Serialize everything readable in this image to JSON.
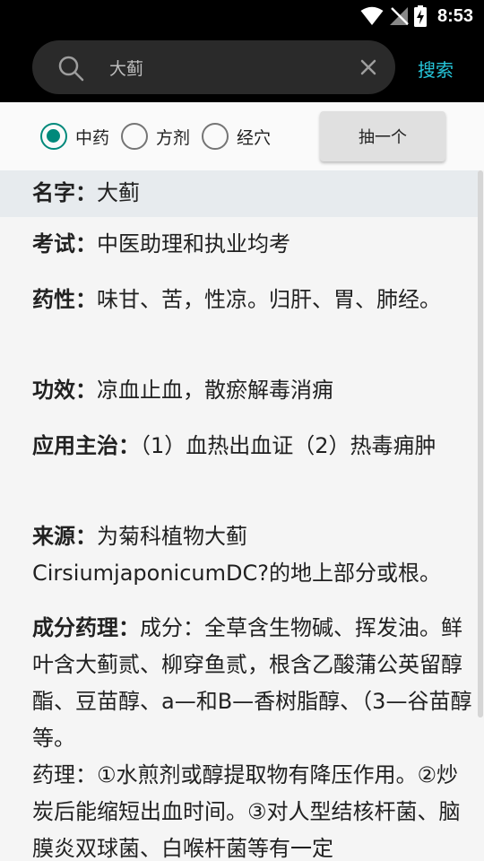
{
  "status_bar": {
    "time": "8:53"
  },
  "search": {
    "value": "大蓟",
    "button_label": "搜索"
  },
  "filters": {
    "options": [
      {
        "label": "中药",
        "checked": true
      },
      {
        "label": "方剂",
        "checked": false
      },
      {
        "label": "经穴",
        "checked": false
      }
    ],
    "random_button_label": "抽一个"
  },
  "entry": {
    "name": {
      "label": "名字：",
      "value": "大蓟"
    },
    "exam": {
      "label": "考试：",
      "value": "中医助理和执业均考"
    },
    "property": {
      "label": "药性：",
      "value": "味甘、苦，性凉。归肝、胃、肺经。"
    },
    "efficacy": {
      "label": "功效：",
      "value": "凉血止血，散瘀解毒消痈"
    },
    "indications": {
      "label": "应用主治：",
      "value": "（1）血热出血证（2）热毒痈肿"
    },
    "source": {
      "label": "来源：",
      "value": "为菊科植物大蓟CirsiumjaponicumDC?的地上部分或根。"
    },
    "components": {
      "label": "成分药理：",
      "value": "成分：全草含生物碱、挥发油。鲜叶含大蓟贰、柳穿鱼贰，根含乙酸蒲公英留醇酯、豆苗醇、a—和B—香树脂醇、（3—谷苗醇等。",
      "value2": "药理：①水煎剂或醇提取物有降压作用。②炒炭后能缩短出血时间。③对人型结核杆菌、脑膜炎双球菌、白喉杆菌等有一定"
    }
  },
  "colors": {
    "accent": "#00897b",
    "search_link": "#26c6da",
    "highlight_row": "#e7ebee"
  }
}
